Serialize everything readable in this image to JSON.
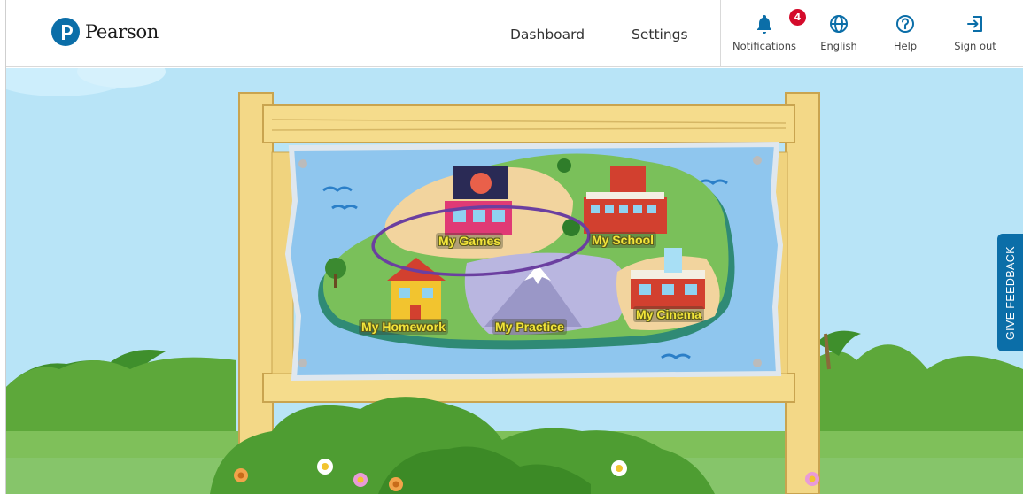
{
  "header": {
    "logo_text": "Pearson",
    "nav": [
      {
        "label": "Dashboard"
      },
      {
        "label": "Settings"
      }
    ],
    "icons": {
      "notifications": {
        "label": "Notifications",
        "badge": "4",
        "icon": "bell-icon"
      },
      "language": {
        "label": "English",
        "icon": "globe-icon"
      },
      "help": {
        "label": "Help",
        "icon": "question-circle-icon"
      },
      "signout": {
        "label": "Sign out",
        "icon": "sign-out-icon"
      }
    },
    "colors": {
      "brand": "#0b6ea8",
      "badge": "#d40b2b"
    }
  },
  "map": {
    "locations": [
      {
        "label": "My Games",
        "highlighted": true
      },
      {
        "label": "My School"
      },
      {
        "label": "My Homework"
      },
      {
        "label": "My Practice"
      },
      {
        "label": "My Cinema"
      }
    ],
    "highlight_color": "#6b3fa0"
  },
  "feedback": {
    "label": "GIVE FEEDBACK"
  }
}
